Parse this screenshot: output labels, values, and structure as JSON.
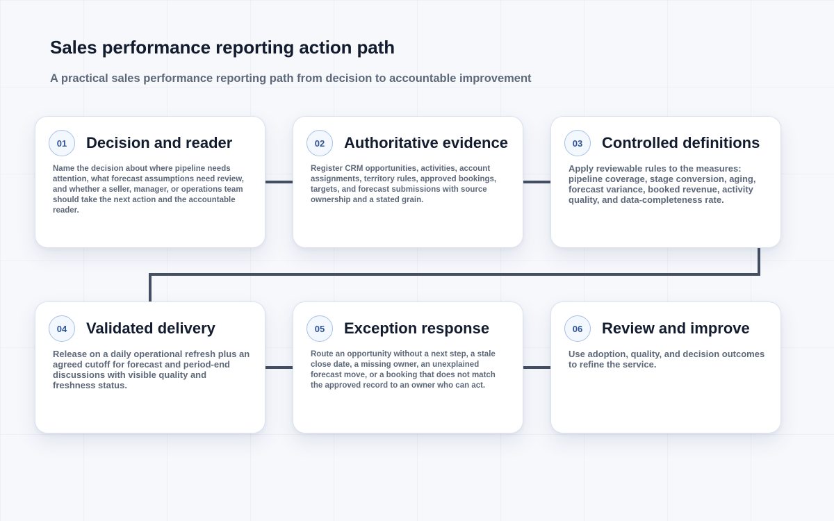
{
  "header": {
    "title": "Sales performance reporting action path",
    "subtitle": "A practical sales performance reporting path from decision to accountable improvement"
  },
  "colors": {
    "connector": "#454f62",
    "badge_text": "#2f5597",
    "badge_border": "#a9c0e6"
  },
  "steps": [
    {
      "number": "01",
      "title": "Decision and reader",
      "body": "Name the decision about where pipeline needs attention, what forecast assumptions need review, and whether a seller, manager, or operations team should take the next action and the accountable reader."
    },
    {
      "number": "02",
      "title": "Authoritative evidence",
      "body": "Register CRM opportunities, activities, account assignments, territory rules, approved bookings, targets, and forecast submissions with source ownership and a stated grain."
    },
    {
      "number": "03",
      "title": "Controlled definitions",
      "body": "Apply reviewable rules to the measures: pipeline coverage, stage conversion, aging, forecast variance, booked revenue, activity quality, and data-completeness rate."
    },
    {
      "number": "04",
      "title": "Validated delivery",
      "body": "Release on a daily operational refresh plus an agreed cutoff for forecast and period-end discussions with visible quality and freshness status."
    },
    {
      "number": "05",
      "title": "Exception response",
      "body": "Route an opportunity without a next step, a stale close date, a missing owner, an unexplained forecast move, or a booking that does not match the approved record to an owner who can act."
    },
    {
      "number": "06",
      "title": "Review and improve",
      "body": "Use adoption, quality, and decision outcomes to refine the service."
    }
  ]
}
